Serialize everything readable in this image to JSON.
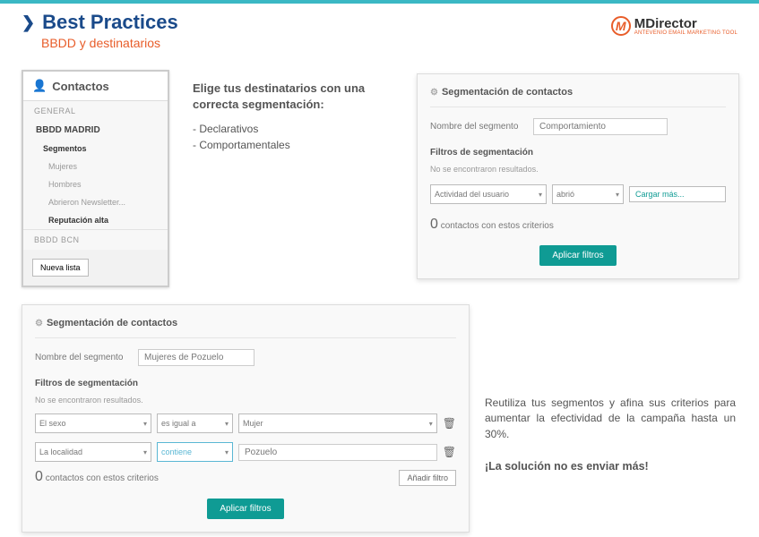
{
  "header": {
    "title": "Best Practices",
    "subtitle": "BBDD y destinatarios",
    "logo_name": "MDirector",
    "logo_tag": "ANTEVENIO EMAIL MARKETING TOOL"
  },
  "contactos": {
    "title": "Contactos",
    "section_general": "GENERAL",
    "bbdd1": "BBDD MADRID",
    "segmentos_label": "Segmentos",
    "items": [
      "Mujeres",
      "Hombres",
      "Abrieron Newsletter...",
      "Reputación alta"
    ],
    "bbdd2": "BBDD BCN",
    "new_list_btn": "Nueva lista"
  },
  "instr1": {
    "heading": "Elige tus destinatarios con una correcta segmentación:",
    "line1": "- Declarativos",
    "line2": "- Comportamentales"
  },
  "seg1": {
    "title": "Segmentación de contactos",
    "name_label": "Nombre del segmento",
    "name_value": "Comportamiento",
    "filters_heading": "Filtros de segmentación",
    "no_results": "No se encontraron resultados.",
    "sel1": "Actividad del usuario",
    "sel2": "abrió",
    "sel3": "Cargar más...",
    "count_zero": "0",
    "count_txt": "contactos con estos criterios",
    "apply_btn": "Aplicar filtros"
  },
  "seg2": {
    "title": "Segmentación de contactos",
    "name_label": "Nombre del segmento",
    "name_value": "Mujeres de Pozuelo",
    "filters_heading": "Filtros de segmentación",
    "no_results": "No se encontraron resultados.",
    "row1": {
      "field": "El sexo",
      "op": "es igual a",
      "val": "Mujer"
    },
    "row2": {
      "field": "La localidad",
      "op": "contiene",
      "val": "Pozuelo"
    },
    "add_btn": "Añadir filtro",
    "count_zero": "0",
    "count_txt": "contactos con estos criterios",
    "apply_btn": "Aplicar filtros"
  },
  "instr2": {
    "body": "Reutiliza tus segmentos y afina sus criterios para aumentar la efectividad de la campaña hasta un 30%.",
    "bold": "¡La solución no es enviar más!"
  }
}
